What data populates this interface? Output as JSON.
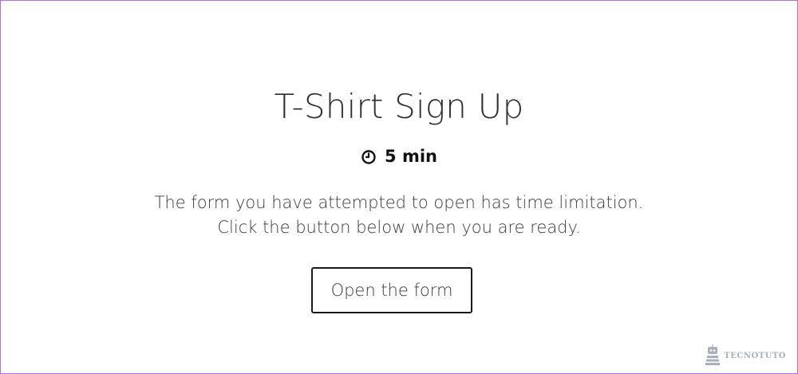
{
  "form": {
    "title": "T-Shirt Sign Up",
    "duration": "5 min",
    "duration_icon": "clock-icon",
    "message_line1": "The form you have attempted to open has time limitation.",
    "message_line2": "Click the button below when you are ready.",
    "open_button_label": "Open the form"
  },
  "watermark": {
    "brand": "TECNOTUTO",
    "icon": "robot-logo-icon"
  },
  "colors": {
    "frame_border": "#b06fe0",
    "text_dark": "#111111",
    "text_body": "#3a3a3a",
    "watermark": "#8a96a6"
  }
}
